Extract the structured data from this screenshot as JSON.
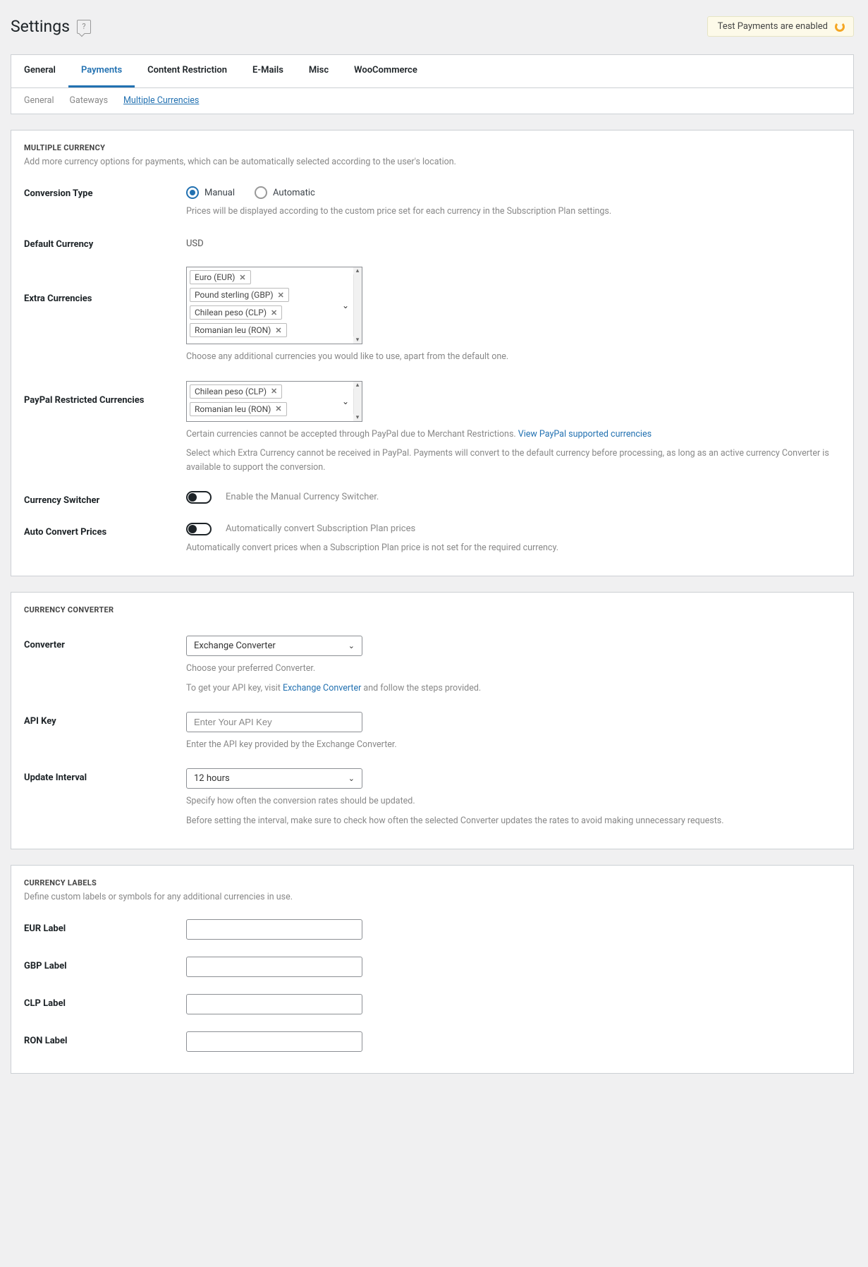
{
  "header": {
    "title": "Settings",
    "notice": "Test Payments are enabled"
  },
  "tabs": {
    "primary": [
      "General",
      "Payments",
      "Content Restriction",
      "E-Mails",
      "Misc",
      "WooCommerce"
    ],
    "primary_active": 1,
    "secondary": [
      "General",
      "Gateways",
      "Multiple Currencies"
    ],
    "secondary_active": 2
  },
  "multiple_currency": {
    "heading": "MULTIPLE CURRENCY",
    "desc": "Add more currency options for payments, which can be automatically selected according to the user's location.",
    "conversion_type": {
      "label": "Conversion Type",
      "options": [
        "Manual",
        "Automatic"
      ],
      "selected": 0,
      "help": "Prices will be displayed according to the custom price set for each currency in the Subscription Plan settings."
    },
    "default_currency": {
      "label": "Default Currency",
      "value": "USD"
    },
    "extra_currencies": {
      "label": "Extra Currencies",
      "chips": [
        "Euro (EUR)",
        "Pound sterling (GBP)",
        "Chilean peso (CLP)",
        "Romanian leu (RON)"
      ],
      "help": "Choose any additional currencies you would like to use, apart from the default one."
    },
    "paypal_restricted": {
      "label": "PayPal Restricted Currencies",
      "chips": [
        "Chilean peso (CLP)",
        "Romanian leu (RON)"
      ],
      "help1_prefix": "Certain currencies cannot be accepted through PayPal due to Merchant Restrictions. ",
      "help1_link": "View PayPal supported currencies",
      "help2": "Select which Extra Currency cannot be received in PayPal. Payments will convert to the default currency before processing, as long as an active currency Converter is available to support the conversion."
    },
    "currency_switcher": {
      "label": "Currency Switcher",
      "toggle_label": "Enable the Manual Currency Switcher."
    },
    "auto_convert": {
      "label": "Auto Convert Prices",
      "toggle_label": "Automatically convert Subscription Plan prices",
      "help": "Automatically convert prices when a Subscription Plan price is not set for the required currency."
    }
  },
  "currency_converter": {
    "heading": "CURRENCY CONVERTER",
    "converter": {
      "label": "Converter",
      "value": "Exchange Converter",
      "help1": "Choose your preferred Converter.",
      "help2_prefix": "To get your API key, visit ",
      "help2_link": "Exchange Converter",
      "help2_suffix": " and follow the steps provided."
    },
    "api_key": {
      "label": "API Key",
      "placeholder": "Enter Your API Key",
      "help": "Enter the API key provided by the Exchange Converter."
    },
    "update_interval": {
      "label": "Update Interval",
      "value": "12 hours",
      "help1": "Specify how often the conversion rates should be updated.",
      "help2": "Before setting the interval, make sure to check how often the selected Converter updates the rates to avoid making unnecessary requests."
    }
  },
  "currency_labels": {
    "heading": "CURRENCY LABELS",
    "desc": "Define custom labels or symbols for any additional currencies in use.",
    "rows": [
      {
        "label": "EUR Label"
      },
      {
        "label": "GBP Label"
      },
      {
        "label": "CLP Label"
      },
      {
        "label": "RON Label"
      }
    ]
  }
}
